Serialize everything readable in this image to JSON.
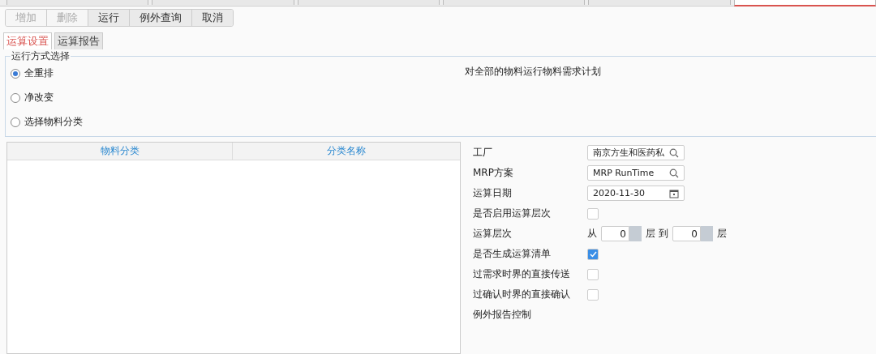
{
  "top_tabs": [
    {
      "selected": false
    },
    {
      "selected": false
    },
    {
      "selected": false
    },
    {
      "selected": false
    },
    {
      "selected": false
    },
    {
      "selected": true
    }
  ],
  "toolbar": [
    {
      "label": "增加",
      "disabled": true
    },
    {
      "label": "删除",
      "disabled": true
    },
    {
      "label": "运行",
      "disabled": false
    },
    {
      "label": "例外查询",
      "disabled": false
    },
    {
      "label": "取消",
      "disabled": false
    }
  ],
  "sub_tabs": [
    {
      "label": "运算设置",
      "selected": true
    },
    {
      "label": "运算报告",
      "selected": false
    }
  ],
  "run_mode": {
    "legend": "运行方式选择",
    "description": "对全部的物料运行物料需求计划",
    "options": [
      {
        "label": "全重排",
        "selected": true
      },
      {
        "label": "净改变",
        "selected": false
      },
      {
        "label": "选择物料分类",
        "selected": false
      }
    ]
  },
  "table": {
    "columns": [
      "物料分类",
      "分类名称"
    ]
  },
  "form": [
    {
      "kind": "lookup",
      "label": "工厂",
      "value": "南京方生和医药私"
    },
    {
      "kind": "lookup",
      "label": "MRP方案",
      "value": "MRP RunTime"
    },
    {
      "kind": "date",
      "label": "运算日期",
      "value": "2020-11-30"
    },
    {
      "kind": "checkbox",
      "label": "是否启用运算层次",
      "checked": false
    },
    {
      "kind": "range",
      "label": "运算层次",
      "from_label": "从",
      "from": "0",
      "mid_label": "层 到",
      "to": "0",
      "end_label": "层"
    },
    {
      "kind": "checkbox",
      "label": "是否生成运算清单",
      "checked": true
    },
    {
      "kind": "checkbox",
      "label": "过需求时界的直接传送",
      "checked": false
    },
    {
      "kind": "checkbox",
      "label": "过确认时界的直接确认",
      "checked": false
    },
    {
      "kind": "label",
      "label": "例外报告控制"
    }
  ]
}
